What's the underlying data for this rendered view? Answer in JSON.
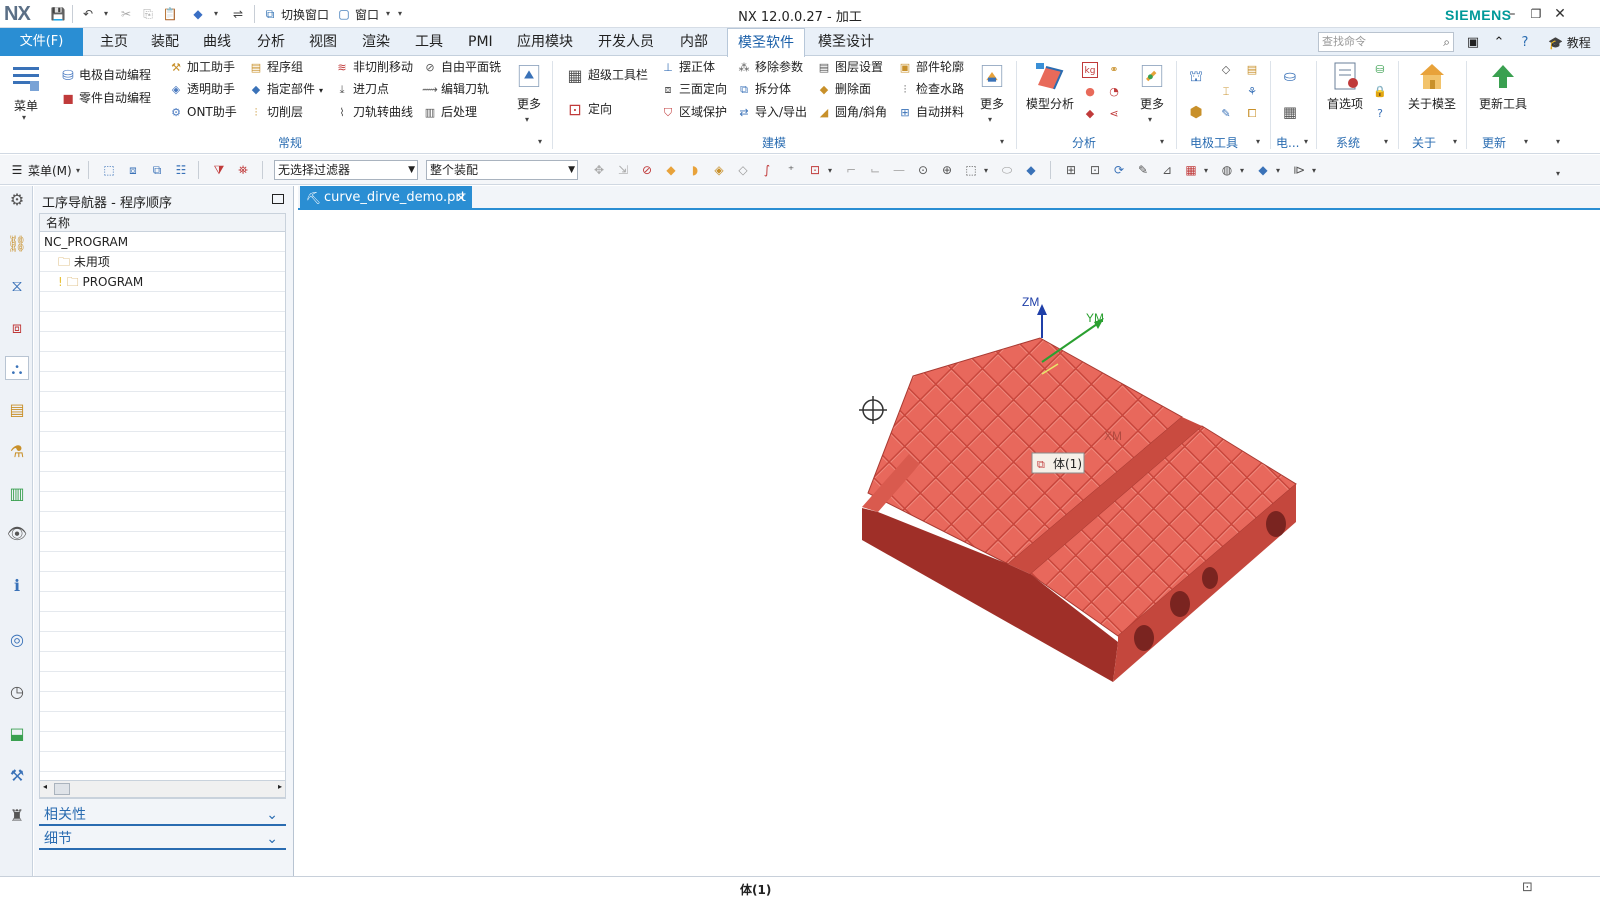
{
  "app": {
    "logo": "NX",
    "title": "NX 12.0.0.27 - 加工",
    "brand": "SIEMENS"
  },
  "quick_access": {
    "switch_window": "切换窗口",
    "window": "窗口"
  },
  "menubar": {
    "file": "文件(F)",
    "tabs": [
      "主页",
      "装配",
      "曲线",
      "分析",
      "视图",
      "渲染",
      "工具",
      "PMI",
      "应用模块",
      "开发人员",
      "内部",
      "模圣软件",
      "模圣设计"
    ],
    "active_tab": "模圣软件",
    "search_placeholder": "查找命令",
    "tutorial": "教程"
  },
  "ribbon": {
    "menu_label": "菜单",
    "group_normal": {
      "name": "常规",
      "items": [
        "电极自动编程",
        "零件自动编程",
        "加工助手",
        "透明助手",
        "ONT助手",
        "程序组",
        "指定部件",
        "切削层",
        "非切削移动",
        "进刀点",
        "刀轨转曲线",
        "自由平面铣",
        "编辑刀轨",
        "后处理"
      ],
      "more": "更多"
    },
    "group_model": {
      "name": "建模",
      "items": [
        "超级工具栏",
        "定向",
        "摆正体",
        "三面定向",
        "区域保护",
        "移除参数",
        "拆分体",
        "导入/导出",
        "图层设置",
        "删除面",
        "圆角/斜角",
        "部件轮廓",
        "检查水路",
        "自动拼料"
      ],
      "more": "更多"
    },
    "group_analysis": {
      "name": "分析",
      "model_analysis": "模型分析",
      "more": "更多"
    },
    "group_electrode": {
      "name": "电极工具"
    },
    "group_elec": {
      "name": "电..."
    },
    "group_system": {
      "name": "系统",
      "prefs": "首选项"
    },
    "group_about": {
      "name": "关于",
      "about": "关于模圣"
    },
    "group_update": {
      "name": "更新",
      "update": "更新工具"
    }
  },
  "selectionbar": {
    "menu": "菜单(M)",
    "filter": "无选择过滤器",
    "scope": "整个装配"
  },
  "navigator": {
    "title": "工序导航器 - 程序顺序",
    "column": "名称",
    "rows": [
      {
        "label": "NC_PROGRAM",
        "indent": 0
      },
      {
        "label": "未用项",
        "indent": 1
      },
      {
        "label": "PROGRAM",
        "indent": 1
      }
    ],
    "sections": [
      "相关性",
      "细节"
    ]
  },
  "document": {
    "tab": "curve_dirve_demo.prt"
  },
  "viewport": {
    "axis_labels": {
      "zm": "ZM",
      "ym": "YM",
      "xm": "XM"
    },
    "tooltip": "体(1)",
    "body_color": "#e8685c"
  },
  "status": {
    "text": "体(1)"
  }
}
